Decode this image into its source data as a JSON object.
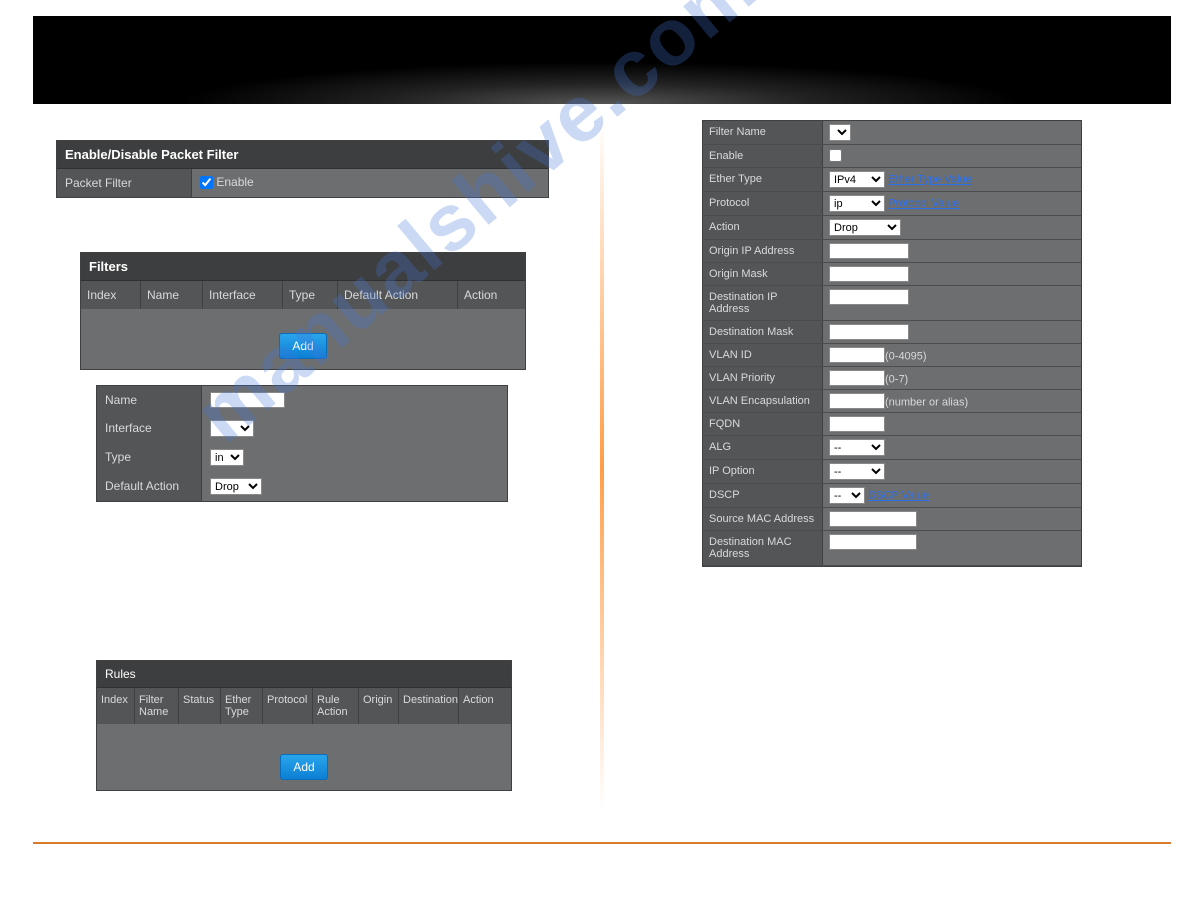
{
  "panel1": {
    "title": "Enable/Disable Packet Filter",
    "row_label": "Packet Filter",
    "checkbox_label": "Enable",
    "checked": true
  },
  "panel2": {
    "title": "Filters",
    "headers": [
      "Index",
      "Name",
      "Interface",
      "Type",
      "Default Action",
      "Action"
    ],
    "add_label": "Add"
  },
  "panel3": {
    "rows": {
      "name_label": "Name",
      "interface_label": "Interface",
      "type_label": "Type",
      "type_value": "in",
      "default_action_label": "Default Action",
      "default_action_value": "Drop"
    }
  },
  "panel4": {
    "title": "Rules",
    "headers": [
      "Index",
      "Filter Name",
      "Status",
      "Ether Type",
      "Protocol",
      "Rule Action",
      "Origin",
      "Destination",
      "Action"
    ],
    "add_label": "Add"
  },
  "panel5": {
    "filter_name_label": "Filter Name",
    "enable_label": "Enable",
    "ether_type_label": "Ether Type",
    "ether_type_value": "IPv4",
    "ether_type_link": "Ether Type Value",
    "protocol_label": "Protocol",
    "protocol_value": "ip",
    "protocol_link": "Protocol Value",
    "action_label": "Action",
    "action_value": "Drop",
    "origin_ip_label": "Origin IP Address",
    "origin_mask_label": "Origin Mask",
    "dest_ip_label": "Destination IP Address",
    "dest_mask_label": "Destination Mask",
    "vlan_id_label": "VLAN ID",
    "vlan_id_hint": "(0-4095)",
    "vlan_prio_label": "VLAN Priority",
    "vlan_prio_hint": "(0-7)",
    "vlan_encap_label": "VLAN Encapsulation",
    "vlan_encap_hint": "(number or alias)",
    "fqdn_label": "FQDN",
    "alg_label": "ALG",
    "alg_value": "--",
    "ip_option_label": "IP Option",
    "ip_option_value": "--",
    "dscp_label": "DSCP",
    "dscp_value": "--",
    "dscp_link": "DSCP Value",
    "src_mac_label": "Source MAC Address",
    "dst_mac_label": "Destination MAC Address"
  },
  "watermark": "manualshive.com"
}
